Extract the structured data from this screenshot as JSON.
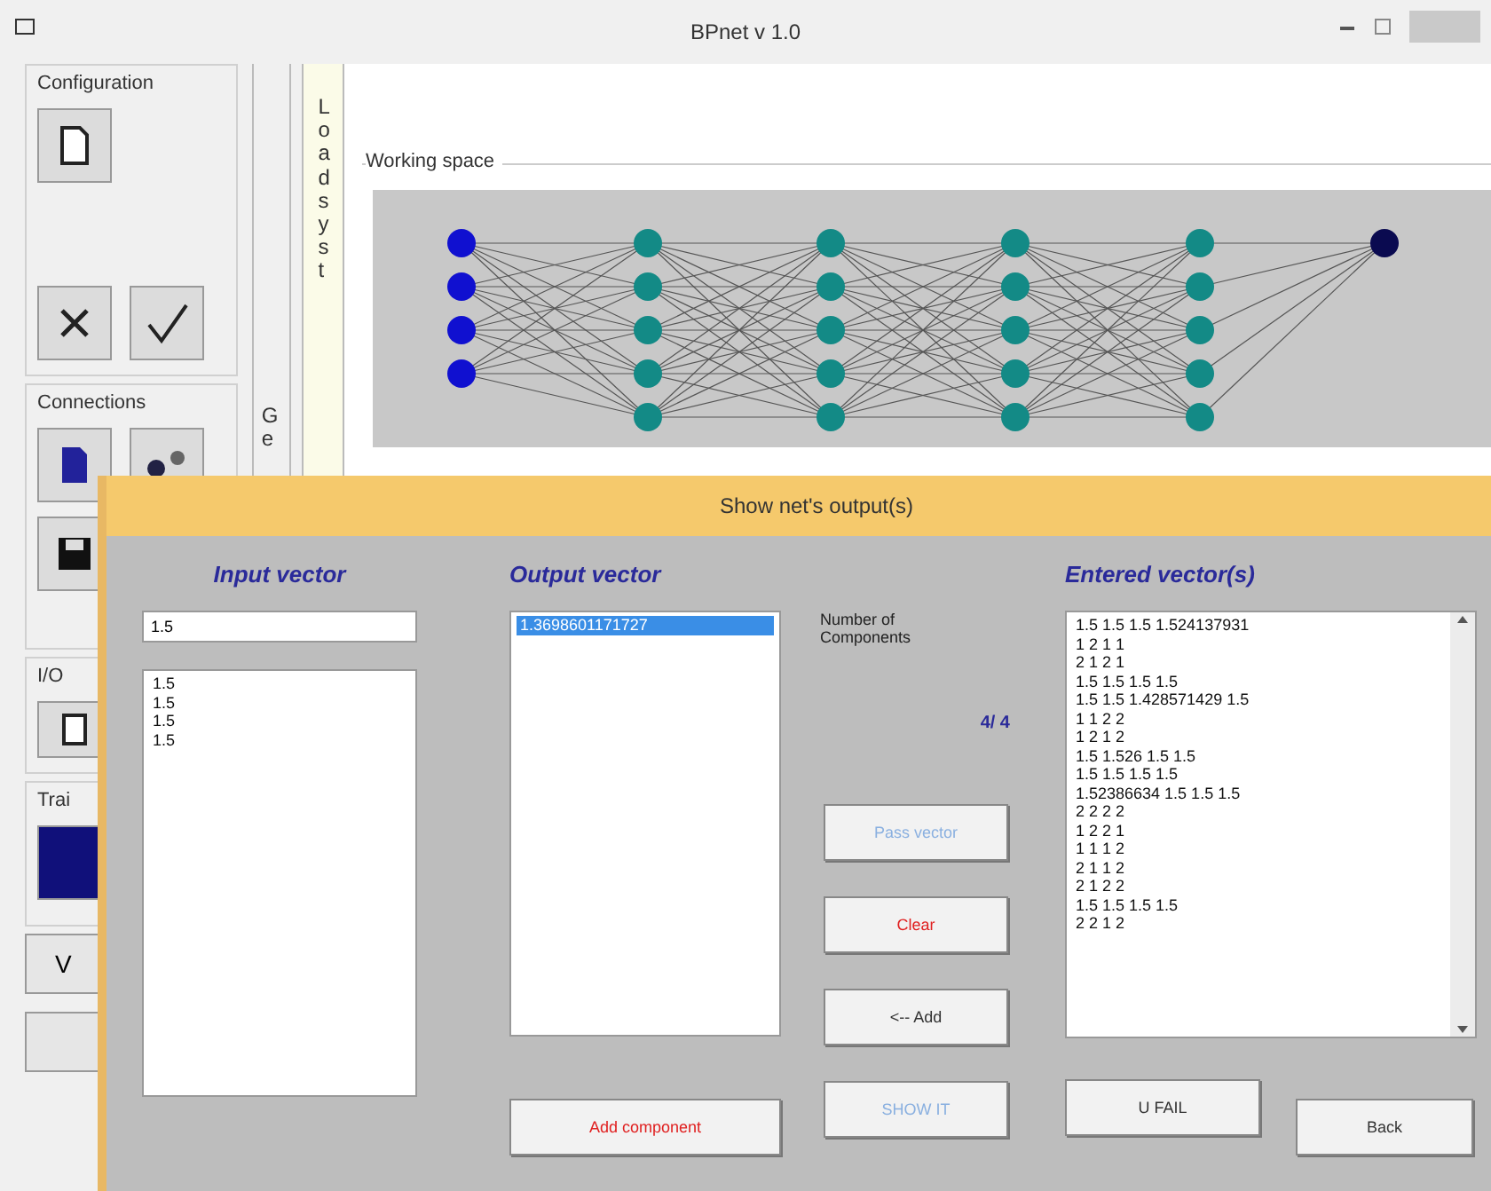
{
  "window": {
    "title": "BPnet v 1.0"
  },
  "sidebar": {
    "groups": [
      {
        "label": "Configuration"
      },
      {
        "label": "Connections"
      },
      {
        "label": "I/O"
      },
      {
        "label": "Trai"
      }
    ],
    "button_label": "V"
  },
  "side_column": {
    "label": "Ge"
  },
  "side_strip": {
    "label": "Load syst"
  },
  "workspace": {
    "label": "Working space"
  },
  "dialog": {
    "title": "Show net's output(s)",
    "input": {
      "heading": "Input vector",
      "value": "1.5",
      "items": [
        "1.5",
        "1.5",
        "1.5",
        "1.5"
      ]
    },
    "output": {
      "heading": "Output vector",
      "items": [
        {
          "text": "1.3698601171727",
          "selected": true
        }
      ]
    },
    "components": {
      "label": "Number of Components",
      "count": "4/ 4"
    },
    "buttons": [
      {
        "label": "Pass vector",
        "kind": "normal",
        "disabled": true
      },
      {
        "label": "Clear",
        "kind": "destructive",
        "disabled": false
      },
      {
        "label": "<-- Add",
        "kind": "normal",
        "disabled": false
      },
      {
        "label": "SHOW IT",
        "kind": "normal",
        "disabled": true
      }
    ],
    "add_component": {
      "label": "Add component",
      "kind": "destructive",
      "disabled": false
    },
    "entered": {
      "heading": "Entered vector(s)",
      "items": [
        "1.5 1.5 1.5 1.524137931",
        "1 2 1 1",
        "2 1 2 1",
        "1.5 1.5 1.5 1.5",
        "1.5 1.5 1.428571429 1.5",
        "1 1 2 2",
        "1 2 1 2",
        "1.5 1.526 1.5 1.5",
        "1.5 1.5 1.5 1.5",
        "1.52386634 1.5 1.5 1.5",
        "2 2 2 2",
        "1 2 2 1",
        "1 1 1 2",
        "2 1 1 2",
        "2 1 2 2",
        "1.5 1.5 1.5 1.5",
        "2 2 1 2"
      ]
    },
    "bottom_buttons": [
      {
        "label": "U FAIL"
      },
      {
        "label": "Back"
      }
    ]
  }
}
